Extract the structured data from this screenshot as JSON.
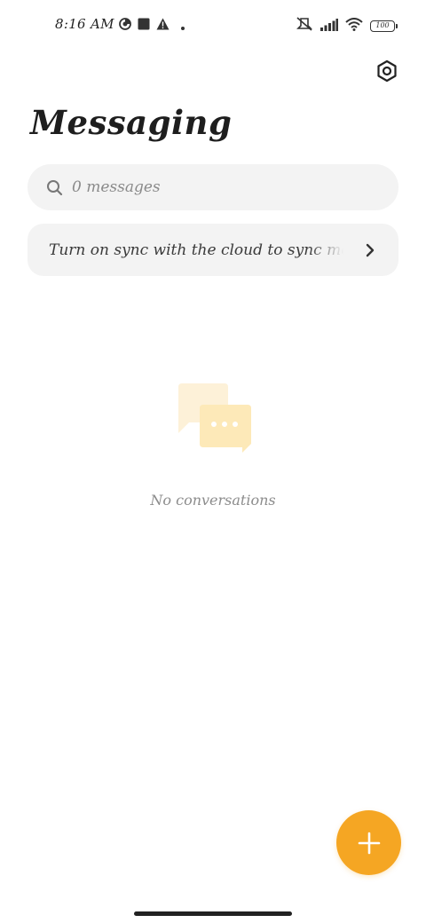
{
  "status_bar": {
    "time": "8:16 AM",
    "battery_level": "100",
    "left_icons": [
      "data-saver-icon",
      "square-notification-icon",
      "warning-icon",
      "dot-icon"
    ],
    "right_icons": [
      "mute-icon",
      "signal-icon",
      "wifi-icon",
      "battery-icon"
    ]
  },
  "header": {
    "title": "Messaging",
    "settings_icon": "settings-icon"
  },
  "search": {
    "placeholder": "0 messages",
    "icon": "search-icon"
  },
  "sync_banner": {
    "text": "Turn on sync with the cloud to sync messages",
    "icon": "chevron-right-icon"
  },
  "empty_state": {
    "icon": "chat-bubbles-icon",
    "text": "No conversations"
  },
  "fab": {
    "icon": "plus-icon",
    "color": "#f5a623"
  },
  "colors": {
    "accent": "#f5a623",
    "card_bg": "#f3f3f3",
    "illustration": "#fde9b8"
  }
}
